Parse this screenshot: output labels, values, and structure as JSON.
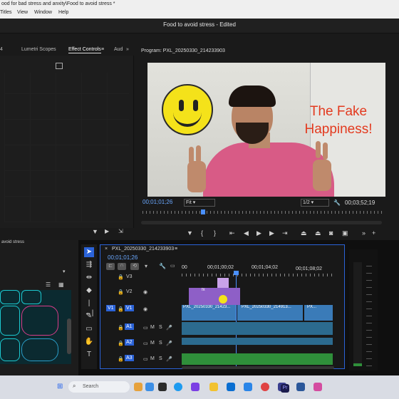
{
  "window": {
    "title_path": "ood for bad stress and anxity\\Food to avoid stress *",
    "menu": [
      "Titles",
      "View",
      "Window",
      "Help"
    ]
  },
  "app": {
    "project_title": "Food to avoid stress - Edited"
  },
  "panel_tabs": {
    "number": "4",
    "lumetri": "Lumetri Scopes",
    "effect_controls": "Effect Controls",
    "audio": "Aud",
    "more": "»"
  },
  "program": {
    "label": "Program: PXL_20250330_214233903",
    "video_text": "The Fake Happiness!",
    "current_timecode": "00;01;01;26",
    "fit": "Fit",
    "resolution": "1/2",
    "duration": "00;03;52;19"
  },
  "project": {
    "label": "avoid stress"
  },
  "timeline": {
    "sequence_name": "PXL_20250330_214233903",
    "timecode": "00;01;01;26",
    "ruler": [
      "00",
      "00;01;00;02",
      "00;01;04;02",
      "00;01;08;02"
    ],
    "tracks": {
      "v3": "V3",
      "v2": "V2",
      "v1": "V1",
      "v1_source": "V1",
      "a1": "A1",
      "a2": "A2",
      "a3": "A3",
      "m": "M",
      "s": "S"
    },
    "clips": {
      "v1_a": "PXL_20250330_21423...",
      "v1_b": "PXL_20250330_214913...",
      "v1_c": "PX...",
      "fx": "fx"
    }
  },
  "taskbar": {
    "search": "Search"
  },
  "colors": {
    "accent_blue": "#2b63d8",
    "timecode_blue": "#6aa8ff",
    "video_text_red": "#e33a1f",
    "clip_purple": "#8e5fc7",
    "clip_blue": "#3a7bb8",
    "audio_green": "#2f8f3a"
  }
}
